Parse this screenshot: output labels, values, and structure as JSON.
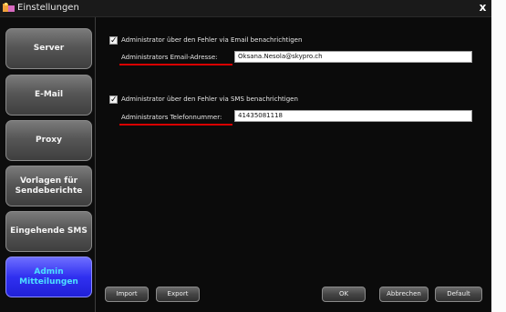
{
  "window": {
    "title": "Einstellungen",
    "close_label": "x"
  },
  "sidebar": {
    "items": [
      {
        "label": "Server"
      },
      {
        "label": "E-Mail"
      },
      {
        "label": "Proxy"
      },
      {
        "label": "Vorlagen für Sendeberichte"
      },
      {
        "label": "Eingehende SMS"
      },
      {
        "label": "Admin Mitteilungen",
        "active": true
      }
    ]
  },
  "email_section": {
    "checkbox_checked": true,
    "checkbox_label": "Administrator über den Fehler via Email benachrichtigen",
    "field_label": "Administrators Email-Adresse:",
    "field_value": "Oksana.Nesola@skypro.ch"
  },
  "sms_section": {
    "checkbox_checked": true,
    "checkbox_label": "Administrator über den Fehler via SMS benachrichtigen",
    "field_label": "Administrators Telefonnummer:",
    "field_value": "41435081118"
  },
  "footer": {
    "import_label": "Import",
    "export_label": "Export",
    "ok_label": "OK",
    "cancel_label": "Abbrechen",
    "default_label": "Default"
  },
  "colors": {
    "accent_active": "#3030f0",
    "underline": "#d80000",
    "background": "#0b0b0b"
  }
}
